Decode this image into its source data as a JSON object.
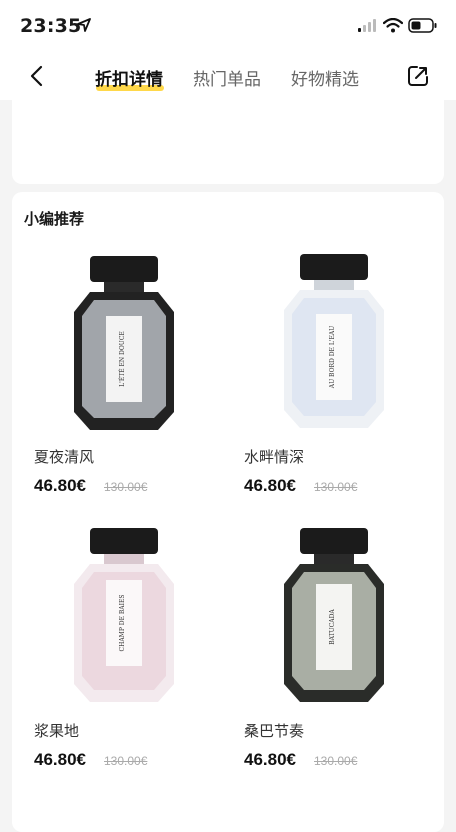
{
  "status_bar": {
    "time": "23:35"
  },
  "nav": {
    "tabs": [
      {
        "label": "折扣详情",
        "active": true
      },
      {
        "label": "热门单品",
        "active": false
      },
      {
        "label": "好物精选",
        "active": false
      }
    ],
    "accent_color": "#ffd84a"
  },
  "section": {
    "title": "小编推荐"
  },
  "products": [
    {
      "name": "夏夜清风",
      "price": "46.80€",
      "original_price": "130.00€",
      "label_text": "L'ÉTÉ EN DOUCE",
      "liquid_color": "#b7bcc2",
      "cap_color": "#1b1b1b"
    },
    {
      "name": "水畔情深",
      "price": "46.80€",
      "original_price": "130.00€",
      "label_text": "AU BORD DE L'EAU",
      "liquid_color": "#dfe6f2",
      "cap_color": "#1b1b1b"
    },
    {
      "name": "浆果地",
      "price": "46.80€",
      "original_price": "130.00€",
      "label_text": "CHAMP DE BAIES",
      "liquid_color": "#ecd8df",
      "cap_color": "#1b1b1b"
    },
    {
      "name": "桑巴节奏",
      "price": "46.80€",
      "original_price": "130.00€",
      "label_text": "BATUCADA",
      "liquid_color": "#a9aea4",
      "cap_color": "#1b1b1b"
    }
  ]
}
